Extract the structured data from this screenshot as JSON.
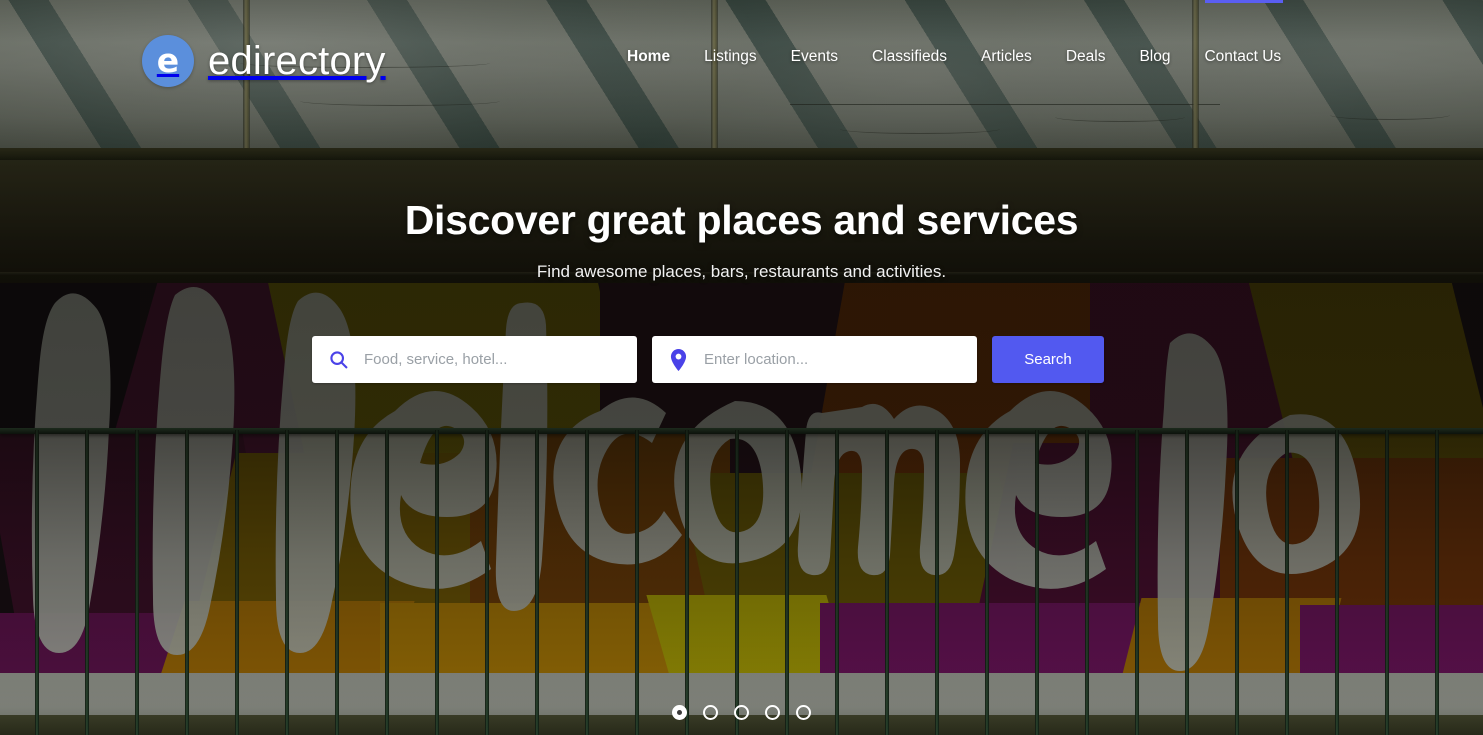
{
  "brand": {
    "logo_letter": "e",
    "name": "edirectory",
    "logo_color": "#5b8fdc"
  },
  "nav": {
    "items": [
      {
        "label": "Home",
        "active": true
      },
      {
        "label": "Listings",
        "active": false
      },
      {
        "label": "Events",
        "active": false
      },
      {
        "label": "Classifieds",
        "active": false
      },
      {
        "label": "Articles",
        "active": false
      },
      {
        "label": "Deals",
        "active": false
      },
      {
        "label": "Blog",
        "active": false
      },
      {
        "label": "Contact Us",
        "active": false
      }
    ]
  },
  "hero": {
    "title": "Discover great places and services",
    "subtitle": "Find awesome places, bars, restaurants and activities.",
    "background_description": "Colorful graffiti mural reading Welcome behind a green fence, below a grey-green wall with diagonal teal stripes"
  },
  "search": {
    "keyword_icon": "search-icon",
    "keyword_value": "",
    "keyword_placeholder": "Food, service, hotel...",
    "location_icon": "map-pin-icon",
    "location_value": "",
    "location_placeholder": "Enter location...",
    "button_label": "Search",
    "button_color": "#5259f0",
    "icon_color": "#4a42e8"
  },
  "carousel": {
    "total": 5,
    "active_index": 0,
    "dots": [
      "1",
      "2",
      "3",
      "4",
      "5"
    ]
  },
  "progress": {
    "color": "#5a5ef2"
  }
}
